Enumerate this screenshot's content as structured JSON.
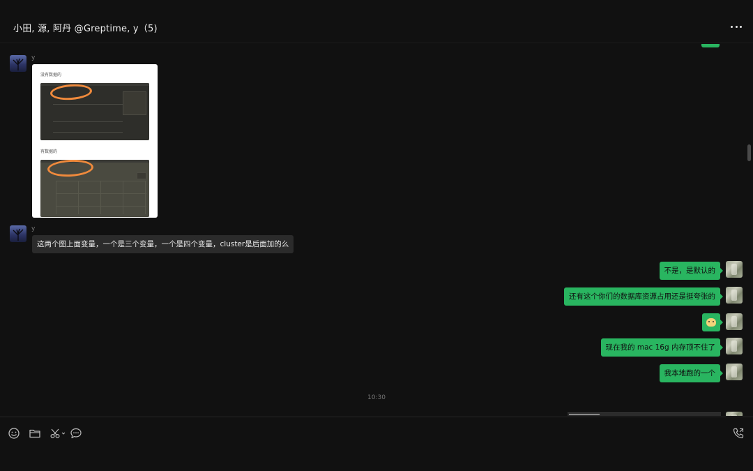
{
  "header": {
    "title": "小田, 源, 阿丹 @Greptime, y（5)",
    "more_icon": "more-dots-icon"
  },
  "messages": [
    {
      "sender": "y",
      "type": "image",
      "image": {
        "caption_1": "没有数据的",
        "caption_2": "有数据的"
      }
    },
    {
      "sender": "y",
      "type": "text",
      "text": "这两个图上面变量，一个是三个变量，一个是四个变量，cluster是后面加的么"
    },
    {
      "sender": "self",
      "type": "text",
      "text": "不是，是默认的"
    },
    {
      "sender": "self",
      "type": "text",
      "text": "还有这个你们的数据库资源占用还是挺夸张的"
    },
    {
      "sender": "self",
      "type": "sticker",
      "sticker": "doge-face-sticker"
    },
    {
      "sender": "self",
      "type": "text",
      "text": "现在我的 mac 16g 内存顶不住了"
    },
    {
      "sender": "self",
      "type": "text",
      "text": "我本地跑的一个"
    }
  ],
  "timestamp": "10:30",
  "toolbar": {
    "icons": [
      "emoji-icon",
      "folder-icon",
      "scissors-icon",
      "chat-history-icon",
      "voice-call-icon"
    ]
  },
  "colors": {
    "background": "#111111",
    "outgoing_bubble": "#29b560",
    "incoming_bubble": "#2b2b2b",
    "annotation": "#f08a3c"
  }
}
